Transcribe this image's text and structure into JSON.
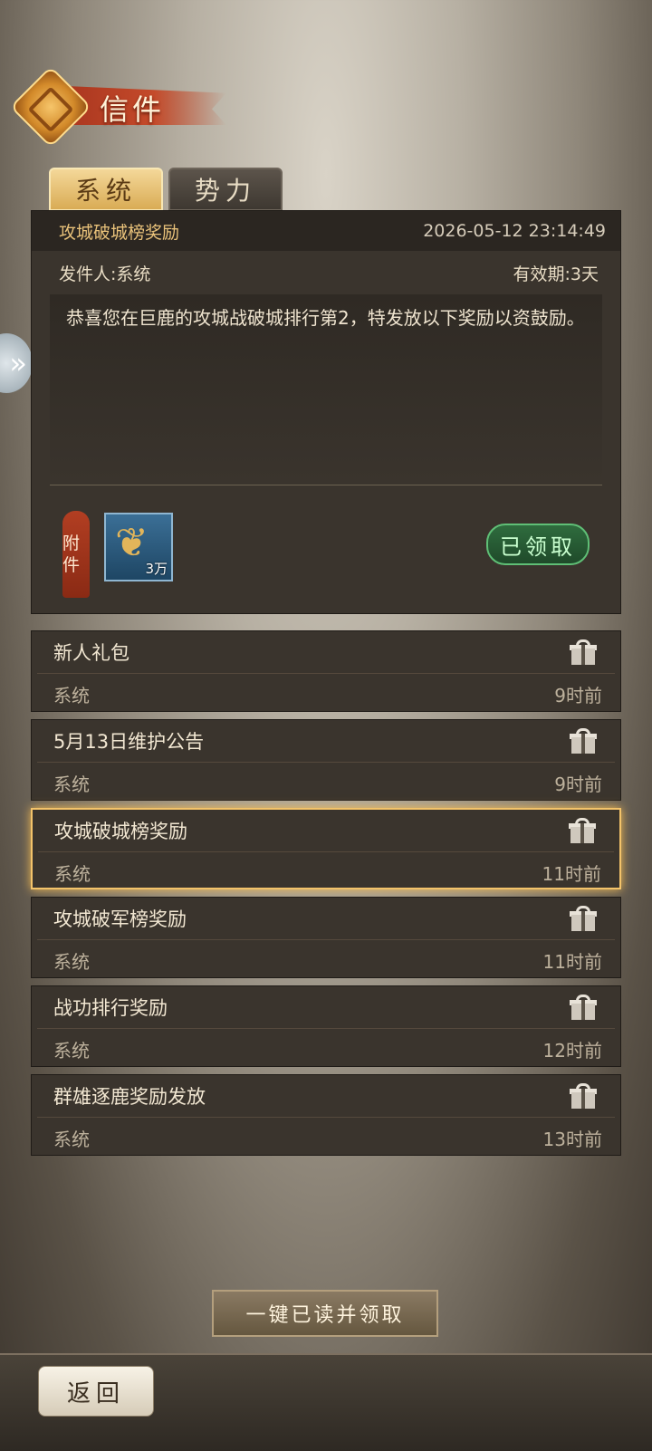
{
  "header": {
    "title": "信件"
  },
  "tabs": [
    {
      "label": "系统",
      "active": true
    },
    {
      "label": "势力",
      "active": false
    }
  ],
  "detail": {
    "subject": "攻城破城榜奖励",
    "datetime": "2026-05-12 23:14:49",
    "sender": "发件人:系统",
    "validity": "有效期:3天",
    "body": "恭喜您在巨鹿的攻城战破城排行第2，特发放以下奖励以资鼓励。",
    "attachment_tag": "附件",
    "attachment_item": {
      "icon": "grain-bundle-icon",
      "quantity": "3万"
    },
    "claimed_label": "已领取"
  },
  "mail_list": [
    {
      "title": "新人礼包",
      "sender": "系统",
      "time": "9时前",
      "selected": false
    },
    {
      "title": "5月13日维护公告",
      "sender": "系统",
      "time": "9时前",
      "selected": false
    },
    {
      "title": "攻城破城榜奖励",
      "sender": "系统",
      "time": "11时前",
      "selected": true
    },
    {
      "title": "攻城破军榜奖励",
      "sender": "系统",
      "time": "11时前",
      "selected": false
    },
    {
      "title": "战功排行奖励",
      "sender": "系统",
      "time": "12时前",
      "selected": false
    },
    {
      "title": "群雄逐鹿奖励发放",
      "sender": "系统",
      "time": "13时前",
      "selected": false
    }
  ],
  "buttons": {
    "read_all": "一键已读并领取",
    "back": "返回"
  },
  "colors": {
    "highlight": "#f3c36a",
    "claimed": "#5fbf76",
    "tab_active": "#d9ac55"
  }
}
